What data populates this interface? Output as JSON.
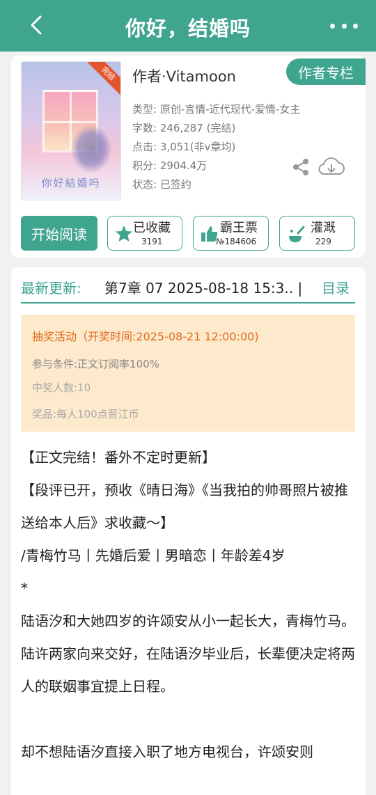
{
  "header": {
    "title": "你好，结婚吗",
    "back_icon": "chevron-left-icon",
    "more_icon": "more-dots-icon"
  },
  "book": {
    "cover_title": "你好結婚吗",
    "cover_badge": "完结",
    "author": "作者·Vitamoon",
    "author_column_button": "作者专栏",
    "type": "类型: 原创-言情-近代现代-爱情-女主",
    "word_count": "字数: 246,287 (完结)",
    "clicks": "点击: 3,051(非v章均)",
    "score": "积分: 2904.4万",
    "status": "状态: 已签约"
  },
  "actions": {
    "read_button": "开始阅读",
    "favorite": {
      "label": "已收藏",
      "count": "3191"
    },
    "bawang": {
      "label": "霸王票",
      "count": "№184606"
    },
    "guangai": {
      "label": "灌溉",
      "count": "229"
    }
  },
  "latest": {
    "label": "最新更新:",
    "chapter": "第7章  07  2025-08-18 15:3.. |",
    "catalog": "目录"
  },
  "lottery": {
    "title": "抽奖活动（开奖时间:2025-08-21 12:00:00)",
    "condition": "参与条件:正文订阅率100%",
    "winners": "中奖人数:10",
    "prize": "奖品:每人100点晋江币"
  },
  "synopsis": {
    "line1": "【正文完结！番外不定时更新】",
    "line2": "【段评已开，预收《晴日海》《当我拍的帅哥照片被推送给本人后》求收藏～】",
    "line3": "/青梅竹马丨先婚后爱丨男暗恋丨年龄差4岁",
    "line4": "*",
    "line5": "陆语汐和大她四岁的许颂安从小一起长大，青梅竹马。",
    "line6": "陆许两家向来交好，在陆语汐毕业后，长辈便决定将两人的联姻事宜提上日程。",
    "line7": "却不想陆语汐直接入职了地方电视台，许颂安则"
  },
  "colors": {
    "brand": "#3fa58f",
    "lottery_bg": "#fde9cb",
    "lottery_title": "#e06a1d"
  }
}
